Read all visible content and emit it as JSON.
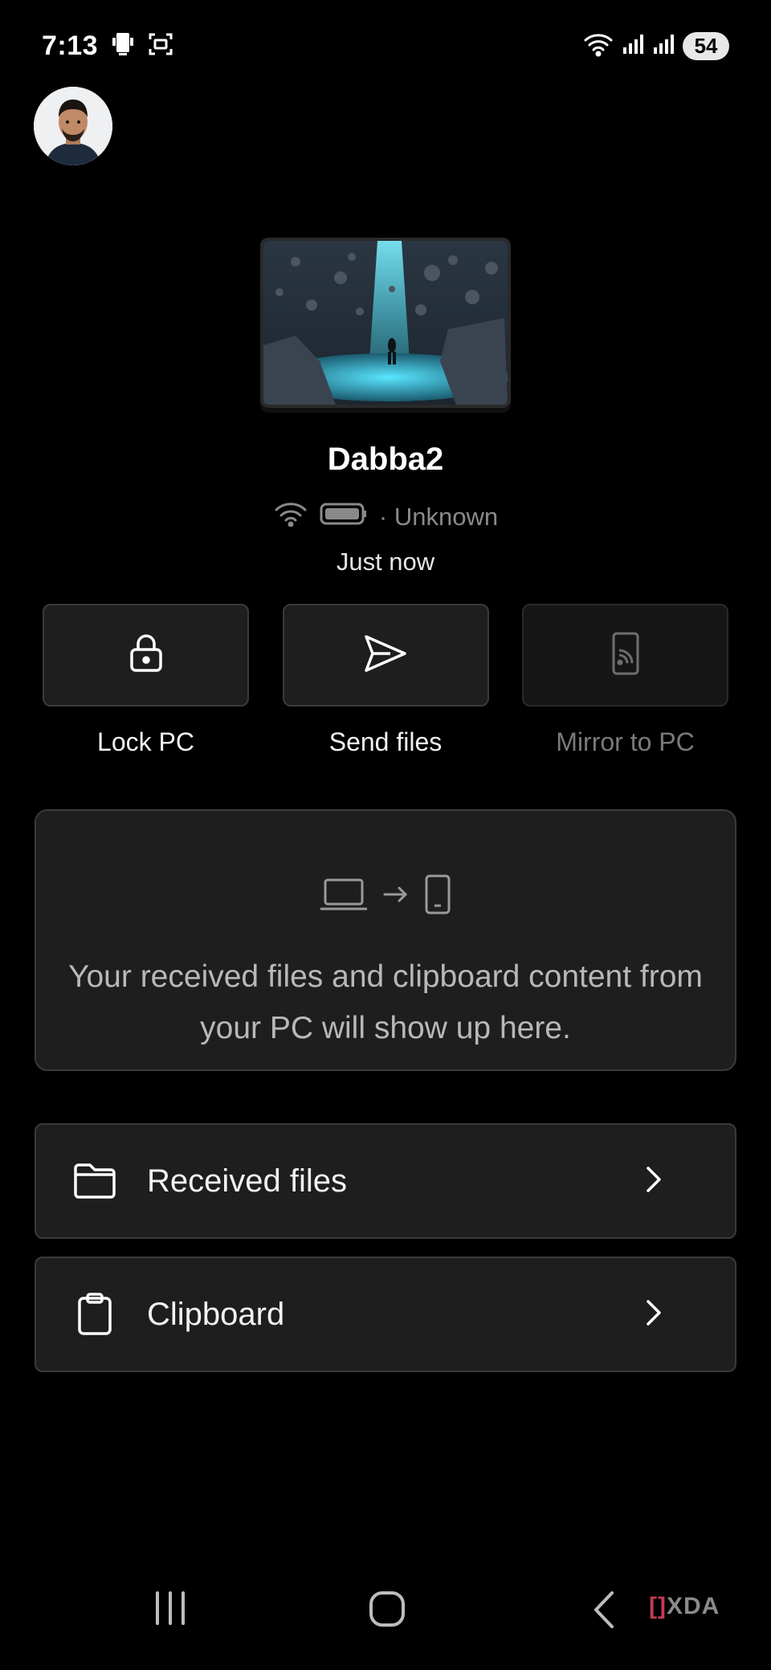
{
  "status_bar": {
    "time": "7:13",
    "battery_level": "54",
    "icons": [
      "screen-mirror-icon",
      "screenshot-icon",
      "wifi-icon",
      "signal-icon",
      "signal-icon"
    ]
  },
  "device": {
    "name": "Dabba2",
    "connection_status": "· Unknown",
    "last_seen": "Just now"
  },
  "actions": [
    {
      "label": "Lock PC",
      "icon": "lock-icon",
      "enabled": true
    },
    {
      "label": "Send files",
      "icon": "send-icon",
      "enabled": true
    },
    {
      "label": "Mirror to PC",
      "icon": "cast-icon",
      "enabled": false
    }
  ],
  "info_card": {
    "message": "Your received files and clipboard content from your PC will show up here."
  },
  "list": [
    {
      "label": "Received files",
      "icon": "folder-icon"
    },
    {
      "label": "Clipboard",
      "icon": "clipboard-icon"
    }
  ],
  "watermark": {
    "bracket": "[]",
    "text": "XDA"
  },
  "colors": {
    "background": "#000000",
    "card": "#1e1e1e",
    "card_border": "#3a3a3a",
    "muted_text": "#8a8a8a",
    "accent_glow": "#3fd8f0"
  }
}
